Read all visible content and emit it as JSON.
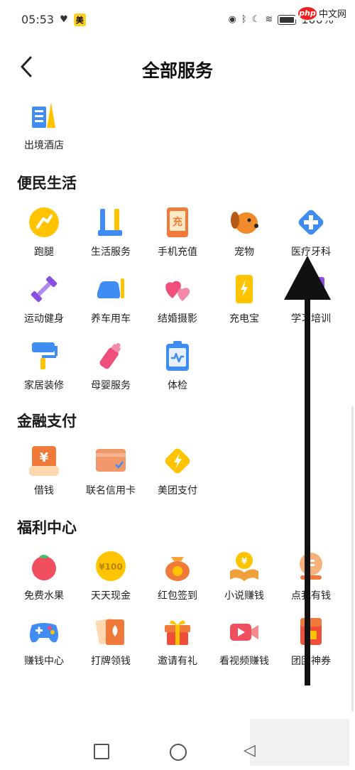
{
  "status": {
    "time": "05:53",
    "badge": "美",
    "battery": "100%"
  },
  "header": {
    "title": "全部服务"
  },
  "watermark": {
    "logo_p": "php",
    "logo_text": "中文网"
  },
  "top_items": [
    {
      "label": "出境酒店",
      "icon": "hotel-icon"
    }
  ],
  "sections": [
    {
      "title": "便民生活",
      "items": [
        {
          "label": "跑腿",
          "icon": "errand-icon"
        },
        {
          "label": "生活服务",
          "icon": "tools-icon"
        },
        {
          "label": "手机充值",
          "icon": "phone-recharge-icon",
          "glyph": "充"
        },
        {
          "label": "宠物",
          "icon": "pet-icon"
        },
        {
          "label": "医疗牙科",
          "icon": "medical-icon"
        },
        {
          "label": "运动健身",
          "icon": "dumbbell-icon"
        },
        {
          "label": "养车用车",
          "icon": "car-icon"
        },
        {
          "label": "结婚摄影",
          "icon": "hearts-icon"
        },
        {
          "label": "充电宝",
          "icon": "power-bank-icon"
        },
        {
          "label": "学习培训",
          "icon": "study-icon"
        },
        {
          "label": "家居装修",
          "icon": "paint-roller-icon"
        },
        {
          "label": "母婴服务",
          "icon": "baby-bottle-icon"
        },
        {
          "label": "体检",
          "icon": "health-check-icon"
        }
      ]
    },
    {
      "title": "金融支付",
      "items": [
        {
          "label": "借钱",
          "icon": "loan-icon",
          "glyph": "¥"
        },
        {
          "label": "联名信用卡",
          "icon": "credit-card-icon"
        },
        {
          "label": "美团支付",
          "icon": "pay-icon"
        }
      ]
    },
    {
      "title": "福利中心",
      "items": [
        {
          "label": "免费水果",
          "icon": "fruit-icon"
        },
        {
          "label": "天天现金",
          "icon": "cash-icon",
          "glyph": "¥100"
        },
        {
          "label": "红包签到",
          "icon": "red-packet-icon"
        },
        {
          "label": "小说赚钱",
          "icon": "novel-icon",
          "glyph": "¥"
        },
        {
          "label": "点我有钱",
          "icon": "coin-icon"
        },
        {
          "label": "赚钱中心",
          "icon": "gamepad-icon"
        },
        {
          "label": "打牌领钱",
          "icon": "cards-icon"
        },
        {
          "label": "邀请有礼",
          "icon": "gift-icon"
        },
        {
          "label": "看视频赚钱",
          "icon": "video-icon"
        },
        {
          "label": "团团神券",
          "icon": "coupon-icon"
        }
      ]
    }
  ],
  "colors": {
    "accent": "#ffc300",
    "blue": "#3f8cf3",
    "orange": "#f07a3a"
  }
}
